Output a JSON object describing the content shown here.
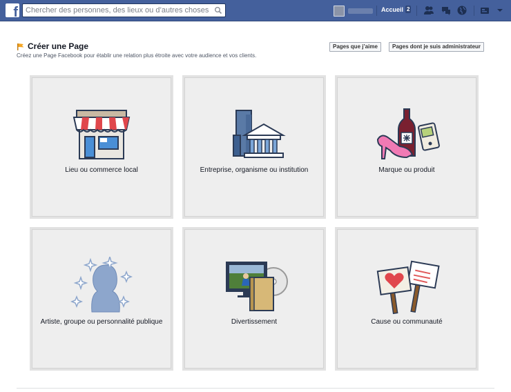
{
  "topbar": {
    "logo": "f",
    "search_placeholder": "Chercher des personnes, des lieux ou d’autres choses",
    "home_label": "Accueil",
    "home_badge": "2"
  },
  "header": {
    "title": "Créer une Page",
    "subtitle": "Créez une Page Facebook pour établir une relation plus étroite avec votre audience et vos clients.",
    "buttons": [
      "Pages que j’aime",
      "Pages dont je suis administrateur"
    ]
  },
  "categories": [
    {
      "label": "Lieu ou commerce local",
      "icon": "storefront-icon"
    },
    {
      "label": "Entreprise, organisme ou institution",
      "icon": "buildings-icon"
    },
    {
      "label": "Marque ou produit",
      "icon": "products-icon"
    },
    {
      "label": "Artiste, groupe ou personnalité publique",
      "icon": "person-silhouette-icon"
    },
    {
      "label": "Divertissement",
      "icon": "entertainment-icon"
    },
    {
      "label": "Cause ou communauté",
      "icon": "signs-icon"
    }
  ],
  "colors": {
    "topbar": "#44609c",
    "card_background": "#eeeeee"
  }
}
